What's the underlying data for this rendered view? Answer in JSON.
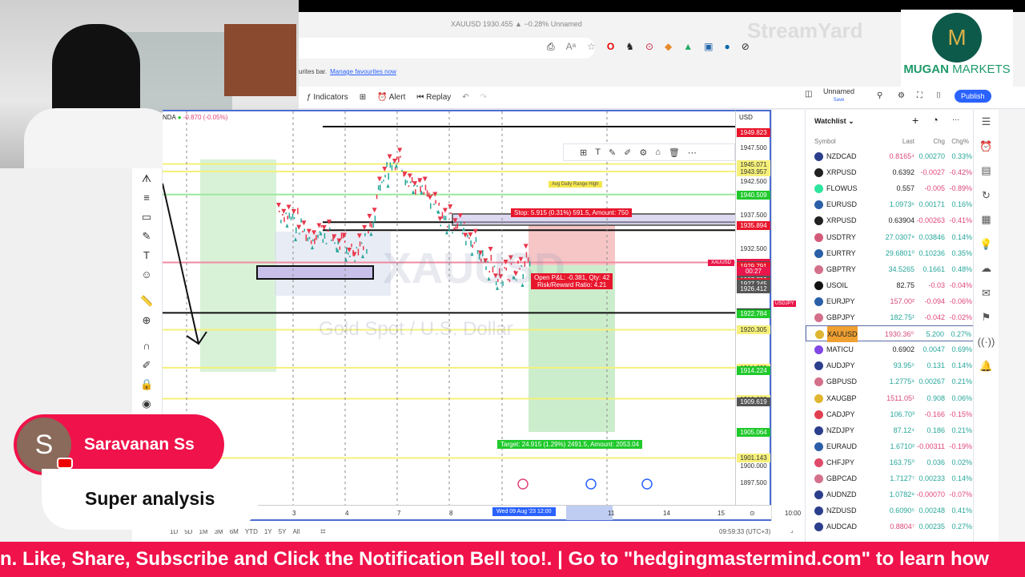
{
  "browser": {
    "tab_title": "XAUUSD 1930.455 ▲ −0.28% Unnamed",
    "fav_text": "urites bar.",
    "fav_link": "Manage favourites now",
    "extensions": [
      "reader-icon",
      "read-aloud-icon",
      "star-icon",
      "opera-icon",
      "extension-icon",
      "download-icon",
      "metamask-icon",
      "extension-icon",
      "extension-icon",
      "extension-icon",
      "extension-icon"
    ]
  },
  "watermark": "StreamYard",
  "toolbar": {
    "indicators": "Indicators",
    "alert": "Alert",
    "replay": "Replay",
    "layout_name": "Unnamed",
    "layout_sub": "Save",
    "publish": "Publish"
  },
  "chart": {
    "symbol_partial": "NDA",
    "change": "-0.870 (-0.05%)",
    "currency": "USD",
    "watermark_symbol": "XAUUSD",
    "watermark_desc": "Gold Spot / U.S. Dollar",
    "stop_label": "Stop: 5.915 (0.31%) 591.5, Amount: 750",
    "pnl_label": "Open P&L: -0.381, Qty: 42",
    "rr_label": "Risk/Reward Ratio: 4.21",
    "target_label": "Target: 24.915 (1.29%) 2491.5, Amount: 2053.04",
    "range_label": "Avg Daily Range High",
    "side_label": "XAUUSD",
    "side_label2": "USDJPY",
    "countdown": "00:27",
    "price_labels": [
      {
        "v": 1949.823,
        "t": "1949.823",
        "bg": "#e8162c",
        "fg": "#fff"
      },
      {
        "v": 1947.5,
        "t": "1947.500",
        "bg": "",
        "fg": "#333"
      },
      {
        "v": 1945.071,
        "t": "1945.071",
        "bg": "#f5f07a",
        "fg": "#333"
      },
      {
        "v": 1943.957,
        "t": "1943.957",
        "bg": "#f5f07a",
        "fg": "#333"
      },
      {
        "v": 1942.5,
        "t": "1942.500",
        "bg": "",
        "fg": "#333"
      },
      {
        "v": 1940.509,
        "t": "1940.509",
        "bg": "#1fc92b",
        "fg": "#fff"
      },
      {
        "v": 1937.5,
        "t": "1937.500",
        "bg": "",
        "fg": "#333"
      },
      {
        "v": 1935.894,
        "t": "1935.894",
        "bg": "#e8162c",
        "fg": "#fff"
      },
      {
        "v": 1932.5,
        "t": "1932.500",
        "bg": "",
        "fg": "#333"
      },
      {
        "v": 1930.36,
        "t": "1930.360",
        "bg": "#e8164a",
        "fg": "#fff"
      },
      {
        "v": 1930.094,
        "t": "1930.094",
        "bg": "#e8164a",
        "fg": "#fff"
      },
      {
        "v": 1929.979,
        "t": "1929.979",
        "bg": "#555",
        "fg": "#fff"
      },
      {
        "v": 1929.792,
        "t": "1929.792",
        "bg": "#555",
        "fg": "#fff"
      },
      {
        "v": 1929.791,
        "t": "1929.791",
        "bg": "#e8162c",
        "fg": "#fff"
      },
      {
        "v": 1927.793,
        "t": "1927.793",
        "bg": "#e8162c",
        "fg": "#fff"
      },
      {
        "v": 1927.792,
        "t": "1927.792",
        "bg": "#555",
        "fg": "#fff"
      },
      {
        "v": 1927.371,
        "t": "1927.371",
        "bg": "#e8162c",
        "fg": "#fff"
      },
      {
        "v": 1927.245,
        "t": "1927.245",
        "bg": "#555",
        "fg": "#fff"
      },
      {
        "v": 1926.413,
        "t": "1926.413",
        "bg": "#e8162c",
        "fg": "#fff"
      },
      {
        "v": 1926.412,
        "t": "1926.412",
        "bg": "#555",
        "fg": "#fff"
      },
      {
        "v": 1922.835,
        "t": "1922.835",
        "bg": "#111",
        "fg": "#fff"
      },
      {
        "v": 1922.784,
        "t": "1922.784",
        "bg": "#1fc92b",
        "fg": "#fff"
      },
      {
        "v": 1920.305,
        "t": "1920.305",
        "bg": "#f5f07a",
        "fg": "#333"
      },
      {
        "v": 1914.628,
        "t": "1914.628",
        "bg": "#f5f07a",
        "fg": "#333"
      },
      {
        "v": 1914.224,
        "t": "1914.224",
        "bg": "#1fc92b",
        "fg": "#fff"
      },
      {
        "v": 1910.0,
        "t": "1910.000",
        "bg": "#f5f07a",
        "fg": "#333"
      },
      {
        "v": 1909.62,
        "t": "1909.620",
        "bg": "#e8162c",
        "fg": "#fff"
      },
      {
        "v": 1909.619,
        "t": "1909.619",
        "bg": "#555",
        "fg": "#fff"
      },
      {
        "v": 1905.064,
        "t": "1905.064",
        "bg": "#1fc92b",
        "fg": "#fff"
      },
      {
        "v": 1901.143,
        "t": "1901.143",
        "bg": "#f5f07a",
        "fg": "#333"
      },
      {
        "v": 1900.0,
        "t": "1900.000",
        "bg": "",
        "fg": "#333"
      },
      {
        "v": 1897.5,
        "t": "1897.500",
        "bg": "",
        "fg": "#333"
      }
    ],
    "time_labels": [
      "3",
      "4",
      "7",
      "8",
      "11",
      "14",
      "15"
    ],
    "crosshair_time": "Wed 09 Aug '23  12:00",
    "right_time": "10:00"
  },
  "bottom": {
    "ranges": [
      "1D",
      "5D",
      "1M",
      "3M",
      "6M",
      "YTD",
      "1Y",
      "5Y",
      "All"
    ],
    "clock": "09:59:33 (UTC+3)"
  },
  "watchlist": {
    "title": "Watchlist",
    "headers": [
      "Symbol",
      "Last",
      "Chg",
      "Chg%"
    ],
    "rows": [
      {
        "s": "NZDCAD",
        "l": "0.8165⁴",
        "c": "0.00270",
        "p": "0.33%",
        "lc": "#d84a7a",
        "cc": "#26a69a",
        "ic": "#2b3f8c"
      },
      {
        "s": "XRPUSD",
        "l": "0.6392",
        "c": "-0.0027",
        "p": "-0.42%",
        "lc": "#222",
        "cc": "#e0457b",
        "ic": "#222"
      },
      {
        "s": "FLOWUS",
        "l": "0.557",
        "c": "-0.005",
        "p": "-0.89%",
        "lc": "#222",
        "cc": "#e0457b",
        "ic": "#2ee59d"
      },
      {
        "s": "EURUSD",
        "l": "1.0973⁶",
        "c": "0.00171",
        "p": "0.16%",
        "lc": "#26a69a",
        "cc": "#26a69a",
        "ic": "#2b5fa8"
      },
      {
        "s": "XRPUSD",
        "l": "0.63904",
        "c": "-0.00263",
        "p": "-0.41%",
        "lc": "#222",
        "cc": "#e0457b",
        "ic": "#222"
      },
      {
        "s": "USDTRY",
        "l": "27.0307⁸",
        "c": "0.03846",
        "p": "0.14%",
        "lc": "#26a69a",
        "cc": "#26a69a",
        "ic": "#d45a7a"
      },
      {
        "s": "EURTRY",
        "l": "29.6801⁰",
        "c": "0.10236",
        "p": "0.35%",
        "lc": "#26a69a",
        "cc": "#26a69a",
        "ic": "#2b5fa8"
      },
      {
        "s": "GBPTRY",
        "l": "34.5265",
        "c": "0.1661",
        "p": "0.48%",
        "lc": "#26a69a",
        "cc": "#26a69a",
        "ic": "#d4708a"
      },
      {
        "s": "USOIL",
        "l": "82.75",
        "c": "-0.03",
        "p": "-0.04%",
        "lc": "#222",
        "cc": "#e0457b",
        "ic": "#111"
      },
      {
        "s": "EURJPY",
        "l": "157.00²",
        "c": "-0.094",
        "p": "-0.06%",
        "lc": "#d84a7a",
        "cc": "#e0457b",
        "ic": "#2b5fa8"
      },
      {
        "s": "GBPJPY",
        "l": "182.75¹",
        "c": "-0.042",
        "p": "-0.02%",
        "lc": "#26a69a",
        "cc": "#e0457b",
        "ic": "#d4708a"
      },
      {
        "s": "XAUUSD",
        "l": "1930.36⁰",
        "c": "5.200",
        "p": "0.27%",
        "lc": "#d84a7a",
        "cc": "#26a69a",
        "ic": "#e0b530",
        "sel": true
      },
      {
        "s": "MATICU",
        "l": "0.6902",
        "c": "0.0047",
        "p": "0.69%",
        "lc": "#222",
        "cc": "#26a69a",
        "ic": "#8247e5"
      },
      {
        "s": "AUDJPY",
        "l": "93.95⁵",
        "c": "0.131",
        "p": "0.14%",
        "lc": "#26a69a",
        "cc": "#26a69a",
        "ic": "#2b3f8c"
      },
      {
        "s": "GBPUSD",
        "l": "1.2775⁹",
        "c": "0.00267",
        "p": "0.21%",
        "lc": "#26a69a",
        "cc": "#26a69a",
        "ic": "#d4708a"
      },
      {
        "s": "XAUGBP",
        "l": "1511.05¹",
        "c": "0.908",
        "p": "0.06%",
        "lc": "#d84a7a",
        "cc": "#26a69a",
        "ic": "#e0b530"
      },
      {
        "s": "CADJPY",
        "l": "106.70³",
        "c": "-0.166",
        "p": "-0.15%",
        "lc": "#26a69a",
        "cc": "#e0457b",
        "ic": "#e04050"
      },
      {
        "s": "NZDJPY",
        "l": "87.12⁴",
        "c": "0.186",
        "p": "0.21%",
        "lc": "#26a69a",
        "cc": "#26a69a",
        "ic": "#2b3f8c"
      },
      {
        "s": "EURAUD",
        "l": "1.6710²",
        "c": "-0.00311",
        "p": "-0.19%",
        "lc": "#26a69a",
        "cc": "#e0457b",
        "ic": "#2b5fa8"
      },
      {
        "s": "CHFJPY",
        "l": "163.75⁰",
        "c": "0.036",
        "p": "0.02%",
        "lc": "#26a69a",
        "cc": "#26a69a",
        "ic": "#e04a6a"
      },
      {
        "s": "GBPCAD",
        "l": "1.7127⁷",
        "c": "0.00233",
        "p": "0.14%",
        "lc": "#26a69a",
        "cc": "#26a69a",
        "ic": "#d4708a"
      },
      {
        "s": "AUDNZD",
        "l": "1.0782⁸",
        "c": "-0.00070",
        "p": "-0.07%",
        "lc": "#26a69a",
        "cc": "#e0457b",
        "ic": "#2b3f8c"
      },
      {
        "s": "NZDUSD",
        "l": "0.6090⁵",
        "c": "0.00248",
        "p": "0.41%",
        "lc": "#26a69a",
        "cc": "#26a69a",
        "ic": "#2b3f8c"
      },
      {
        "s": "AUDCAD",
        "l": "0.8804⁷",
        "c": "0.00235",
        "p": "0.27%",
        "lc": "#d84a7a",
        "cc": "#26a69a",
        "ic": "#2b3f8c"
      }
    ]
  },
  "logo": {
    "text1": "MUGAN",
    "text2": " MARKETS"
  },
  "comment": {
    "initial": "S",
    "name": "Saravanan Ss",
    "text": "Super analysis"
  },
  "banner": "n. Like, Share, Subscribe and Click the Notification Bell too!. | Go to \"hedgingmastermind.com\" to learn how",
  "colors": {
    "accent": "#2962ff",
    "banner": "#f0124a",
    "up": "#26a69a",
    "down": "#e0457b"
  }
}
